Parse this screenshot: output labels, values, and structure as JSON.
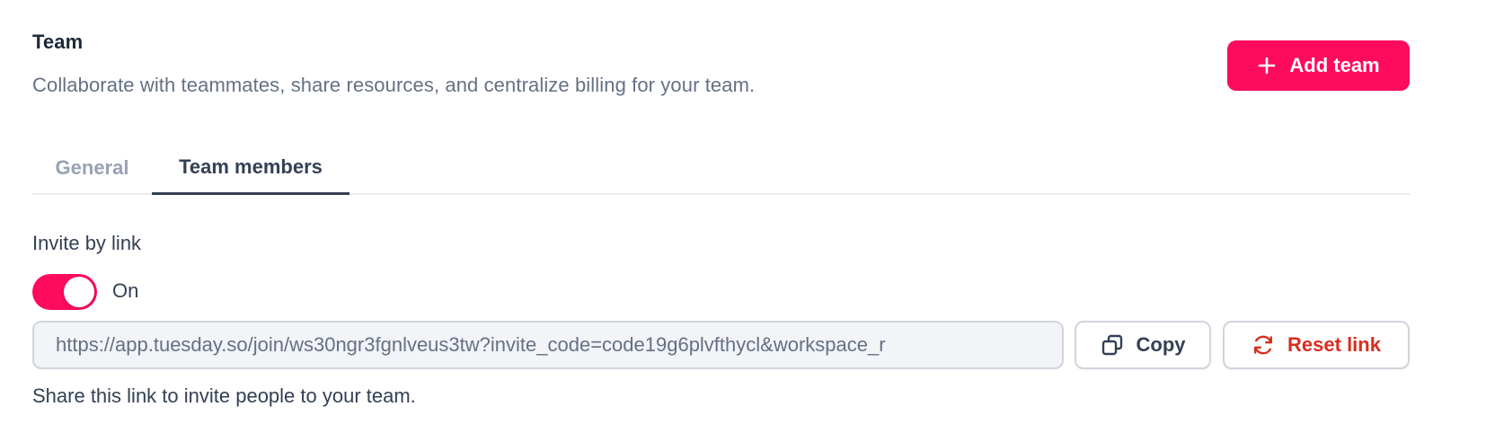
{
  "header": {
    "title": "Team",
    "subtitle": "Collaborate with teammates, share resources, and centralize billing for your team.",
    "add_team_label": "Add team",
    "add_team_icon": "plus-icon"
  },
  "tabs": [
    {
      "label": "General",
      "active": false
    },
    {
      "label": "Team members",
      "active": true
    }
  ],
  "invite": {
    "label": "Invite by link",
    "toggle_state": "On",
    "toggle_on": true,
    "link_value": "https://app.tuesday.so/join/ws30ngr3fgnlveus3tw?invite_code=code19g6plvfthycl&workspace_r",
    "copy_label": "Copy",
    "copy_icon": "copy-icon",
    "reset_label": "Reset link",
    "reset_icon": "refresh-icon",
    "help_text": "Share this link to invite people to your team."
  },
  "colors": {
    "accent": "#fe0b5e",
    "danger": "#d92d20",
    "text_primary": "#344054",
    "text_muted": "#667085"
  }
}
